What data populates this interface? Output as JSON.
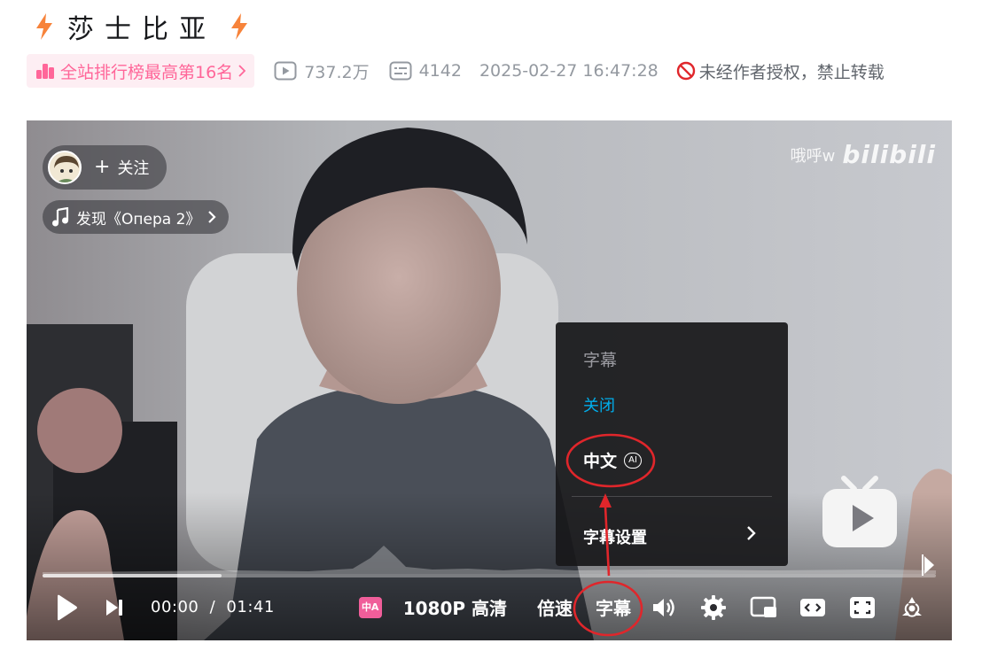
{
  "video": {
    "title": "莎士比亚",
    "rank_badge": "全站排行榜最高第16名",
    "views": "737.2万",
    "danmaku": "4142",
    "publish_time": "2025-02-27 16:47:28",
    "copyright_notice": "未经作者授权，禁止转载"
  },
  "player": {
    "follow_label": "关注",
    "music_label": "发现《Опера 2》",
    "watermark_user": "哦呼w",
    "watermark_logo": "bilibili",
    "current_time": "00:00",
    "time_separator": "/",
    "duration": "01:41",
    "ai_chip_label": "中A",
    "quality_label": "1080P 高清",
    "speed_label": "倍速",
    "subtitle_label": "字幕",
    "progress_buffered_fraction": 0.2
  },
  "subtitle_menu": {
    "title": "字幕",
    "off_label": "关闭",
    "chinese_label": "中文",
    "ai_badge": "AI",
    "settings_label": "字幕设置"
  },
  "colors": {
    "brand_pink": "#ff6699",
    "brand_blue": "#00aeec",
    "annotation_red": "#e0262b",
    "meta_gray": "#9499a0"
  }
}
